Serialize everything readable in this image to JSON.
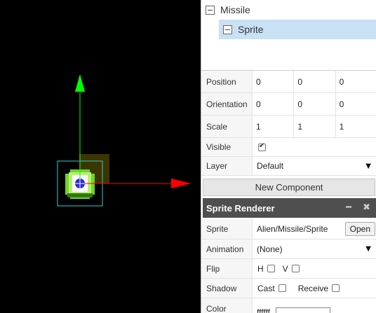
{
  "tree": {
    "items": [
      {
        "label": "Missile"
      },
      {
        "label": "Sprite"
      }
    ]
  },
  "transform": {
    "position": {
      "label": "Position",
      "x": "0",
      "y": "0",
      "z": "0"
    },
    "orientation": {
      "label": "Orientation",
      "x": "0",
      "y": "0",
      "z": "0"
    },
    "scale": {
      "label": "Scale",
      "x": "1",
      "y": "1",
      "z": "1"
    }
  },
  "visible": {
    "label": "Visible",
    "checked": true
  },
  "layer": {
    "label": "Layer",
    "value": "Default"
  },
  "new_component_label": "New Component",
  "sprite_renderer": {
    "title": "Sprite Renderer",
    "minimize_icon": "minus-icon",
    "close_icon": "close-icon",
    "sprite": {
      "label": "Sprite",
      "value": "Alien/Missile/Sprite",
      "open_label": "Open"
    },
    "animation": {
      "label": "Animation",
      "value": "(None)"
    },
    "flip": {
      "label": "Flip",
      "h_label": "H",
      "v_label": "V"
    },
    "shadow": {
      "label": "Shadow",
      "cast_label": "Cast",
      "receive_label": "Receive"
    },
    "color": {
      "label": "Color",
      "value": "ffffff"
    }
  },
  "colors": {
    "selection": "#c9e1f5",
    "header": "#4f4f4f",
    "gizmo_y": "#00ff00",
    "gizmo_x": "#ff0000",
    "bounds": "#33cccc"
  }
}
